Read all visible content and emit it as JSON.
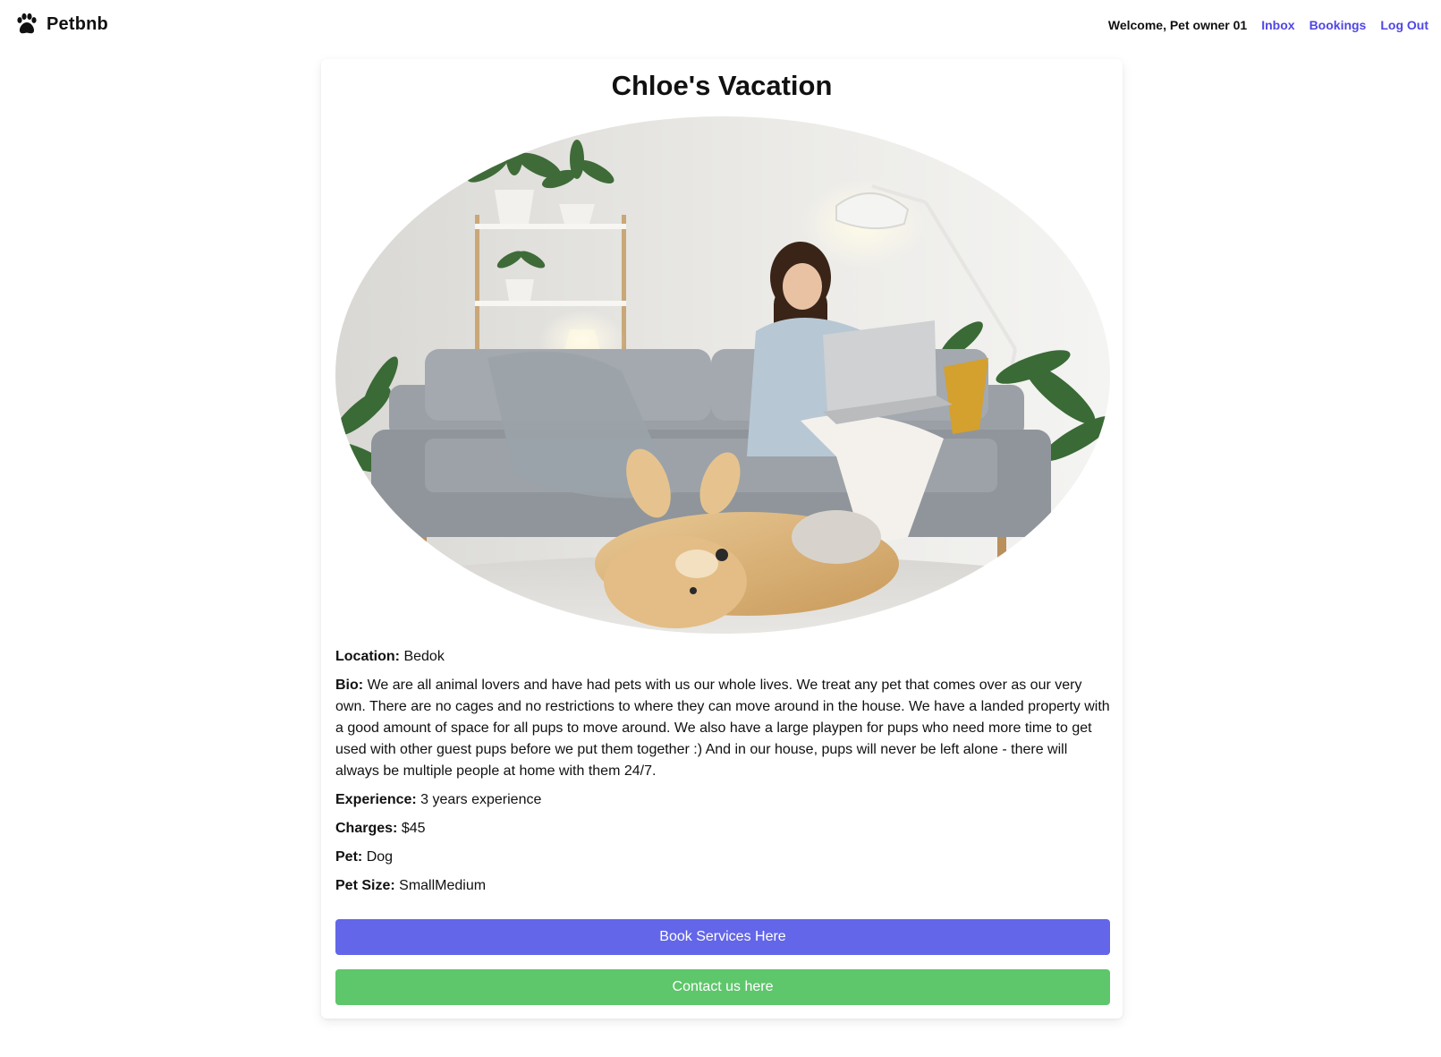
{
  "header": {
    "brand": "Petbnb",
    "brand_icon": "paw-icon",
    "welcome": "Welcome, Pet owner 01",
    "nav": {
      "inbox": "Inbox",
      "bookings": "Bookings",
      "logout": "Log Out"
    },
    "link_color": "#4f46e5"
  },
  "listing": {
    "title": "Chloe's Vacation",
    "photo_alt": "Woman on grey sofa with laptop and golden retriever",
    "location_label": "Location:",
    "location": "Bedok",
    "bio_label": "Bio:",
    "bio": "We are all animal lovers and have had pets with us our whole lives. We treat any pet that comes over as our very own. There are no cages and no restrictions to where they can move around in the house. We have a landed property with a good amount of space for all pups to move around. We also have a large playpen for pups who need more time to get used with other guest pups before we put them together :) And in our house, pups will never be left alone - there will always be multiple people at home with them 24/7.",
    "experience_label": "Experience:",
    "experience": "3 years experience",
    "charges_label": "Charges:",
    "charges": "$45",
    "pet_label": "Pet:",
    "pet": "Dog",
    "pet_size_label": "Pet Size:",
    "pet_size": "SmallMedium"
  },
  "actions": {
    "book_label": "Book Services Here",
    "book_color": "#6366e8",
    "contact_label": "Contact us here",
    "contact_color": "#5ec66b"
  }
}
